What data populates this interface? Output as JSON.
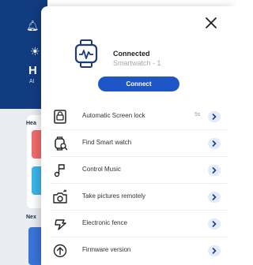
{
  "background": {
    "hero_initial": "H",
    "hero_subtext": "Al",
    "label_1": "Hea",
    "label_2": "Nex"
  },
  "drawer": {
    "status": "Connected",
    "device_name": "Smartwatch - 1",
    "connect_label": "Connect",
    "items": [
      {
        "label": "Automatic Screen lock",
        "value": "5s",
        "icon": "screen-lock-icon"
      },
      {
        "label": "Find Smart watch",
        "value": "",
        "icon": "find-watch-icon"
      },
      {
        "label": "Control Music",
        "value": "",
        "icon": "music-icon"
      },
      {
        "label": "Take pictures remotely",
        "value": "",
        "icon": "camera-icon"
      },
      {
        "label": "Electronic fence",
        "value": "",
        "icon": "fence-icon"
      },
      {
        "label": "Firmware version",
        "value": "",
        "icon": "firmware-icon"
      }
    ]
  },
  "colors": {
    "accent": "#1e56c8",
    "hero_bg": "#123c80",
    "chevron_bg": "#e2ebf9"
  }
}
